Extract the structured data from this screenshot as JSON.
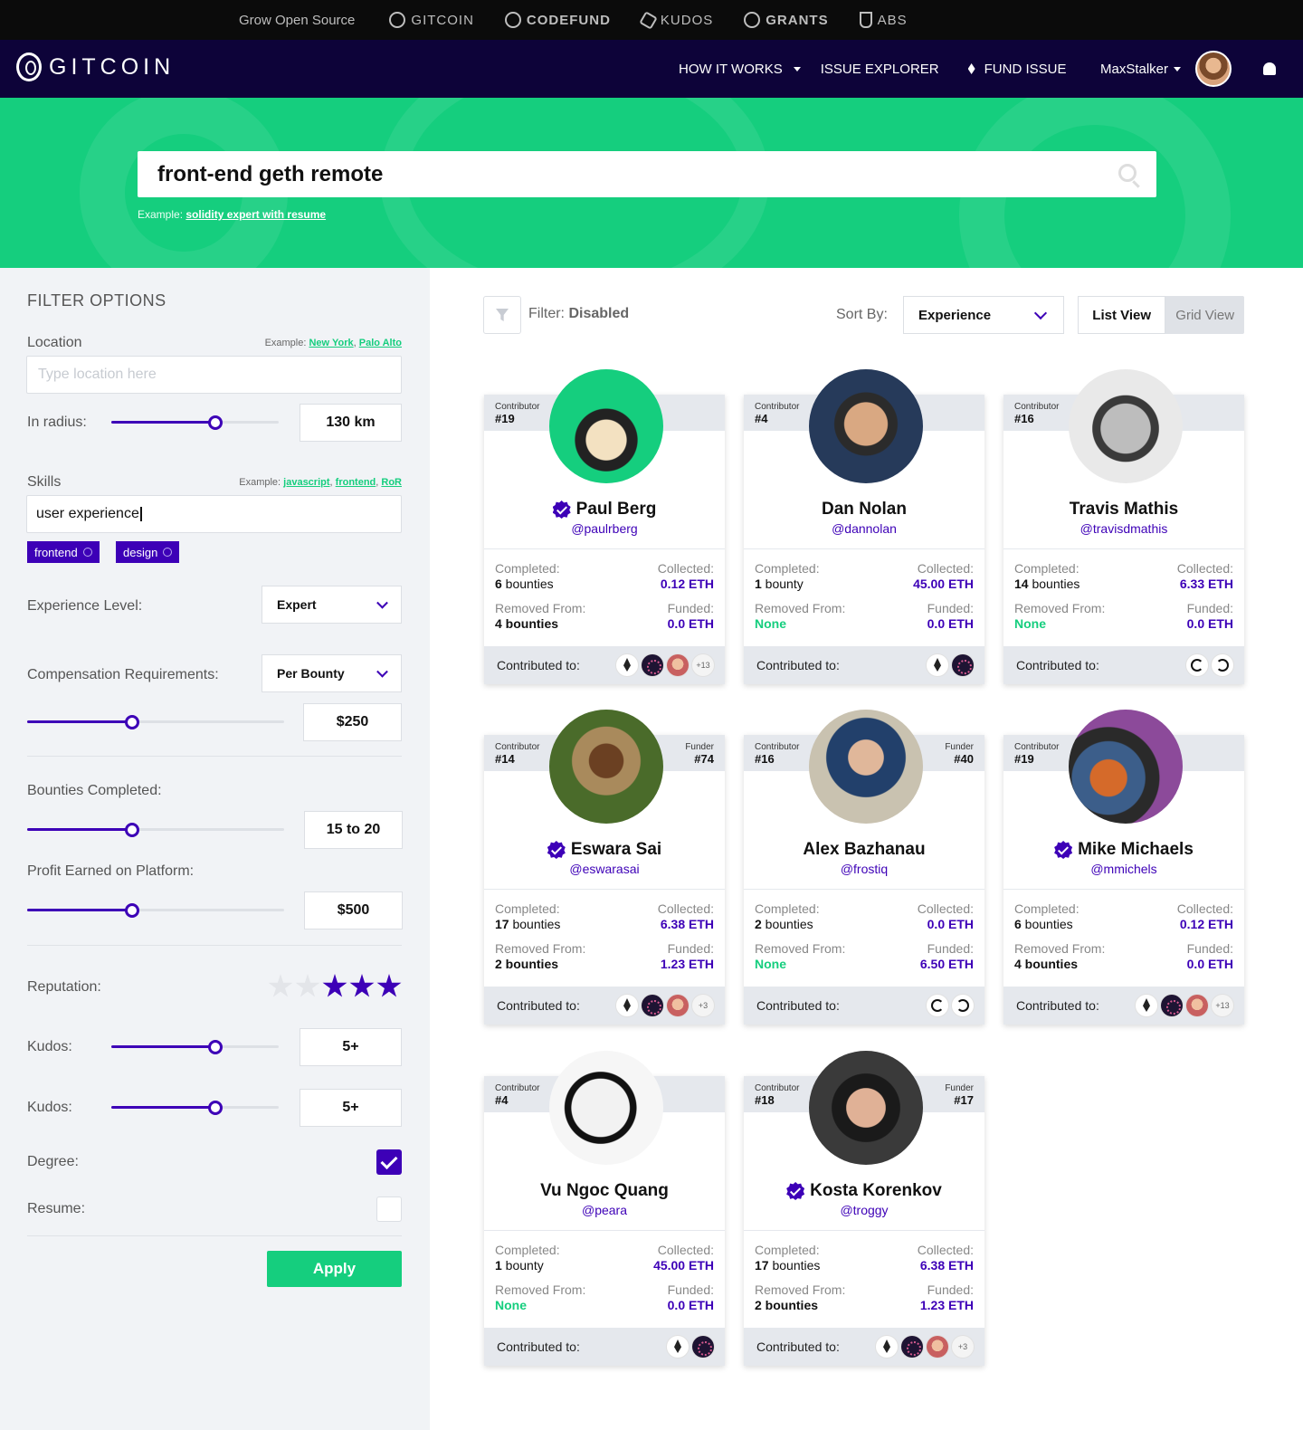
{
  "topbar": {
    "items": [
      "Grow Open Source",
      "GITCOIN",
      "CODEFUND",
      "KUDOS",
      "GRANTS",
      "ABS"
    ]
  },
  "nav": {
    "logo": "GITCOIN",
    "how_it_works": "HOW IT WORKS",
    "issue_explorer": "ISSUE EXPLORER",
    "fund_issue": "FUND ISSUE",
    "username": "MaxStalker"
  },
  "hero": {
    "search_value": "front-end geth remote",
    "example_prefix": "Example:",
    "example_link": "solidity expert with resume"
  },
  "filters": {
    "title": "FILTER OPTIONS",
    "location_label": "Location",
    "location_example_prefix": "Example:",
    "location_example_1": "New York",
    "location_example_2": "Palo Alto",
    "location_placeholder": "Type location here",
    "radius_label": "In radius:",
    "radius_value": "130 km",
    "radius_level": 0.62,
    "skills_label": "Skills",
    "skills_example_prefix": "Example:",
    "skills_example_1": "javascript",
    "skills_example_2": "frontend",
    "skills_example_3": "RoR",
    "skills_value": "user experience",
    "tags": [
      "frontend",
      "design"
    ],
    "experience_label": "Experience Level:",
    "experience_value": "Expert",
    "compensation_label": "Compensation Requirements:",
    "compensation_value": "Per Bounty",
    "compensation_amount": "$250",
    "compensation_level": 0.41,
    "bounties_label": "Bounties Completed:",
    "bounties_value": "15 to 20",
    "bounties_level": 0.41,
    "profit_label": "Profit Earned on Platform:",
    "profit_value": "$500",
    "profit_level": 0.41,
    "reputation_label": "Reputation:",
    "reputation_stars": 3,
    "reputation_max": 5,
    "kudos_label": "Kudos:",
    "kudos_value": "5+",
    "kudos_level": 0.62,
    "kudos2_label": "Kudos:",
    "kudos2_value": "5+",
    "kudos2_level": 0.62,
    "degree_label": "Degree:",
    "degree_checked": true,
    "resume_label": "Resume:",
    "resume_checked": false,
    "apply_label": "Apply"
  },
  "toolbar": {
    "filter_prefix": "Filter:",
    "filter_state": "Disabled",
    "sort_label": "Sort By:",
    "sort_value": "Experience",
    "list_view": "List View",
    "grid_view": "Grid View"
  },
  "labels": {
    "contributor": "Contributor",
    "funder": "Funder",
    "completed": "Completed:",
    "collected": "Collected:",
    "removed_from": "Removed From:",
    "funded": "Funded:",
    "contributed_to": "Contributed to:"
  },
  "cards": [
    {
      "contributor_rank": "#19",
      "funder_rank": "",
      "name": "Paul Berg",
      "handle": "@paulrberg",
      "verified": true,
      "completed_num": "6",
      "completed_unit": " bounties",
      "collected": "0.12 ETH",
      "removed_num": "4",
      "removed_unit": " bounties",
      "removed_none": false,
      "funded": "0.0 ETH",
      "chips": [
        "eth",
        "dark",
        "face",
        "+13"
      ]
    },
    {
      "contributor_rank": "#4",
      "funder_rank": "",
      "name": "Dan Nolan",
      "handle": "@dannolan",
      "verified": false,
      "completed_num": "1",
      "completed_unit": " bounty",
      "collected": "45.00 ETH",
      "removed_num": "None",
      "removed_unit": "",
      "removed_none": true,
      "funded": "0.0 ETH",
      "chips": [
        "eth",
        "dark"
      ]
    },
    {
      "contributor_rank": "#16",
      "funder_rank": "",
      "name": "Travis Mathis",
      "handle": "@travisdmathis",
      "verified": false,
      "completed_num": "14",
      "completed_unit": " bounties",
      "collected": "6.33 ETH",
      "removed_num": "None",
      "removed_unit": "",
      "removed_none": true,
      "funded": "0.0 ETH",
      "chips": [
        "ring1",
        "ring2"
      ]
    },
    {
      "contributor_rank": "#14",
      "funder_rank": "#74",
      "name": "Eswara Sai",
      "handle": "@eswarasai",
      "verified": true,
      "completed_num": "17",
      "completed_unit": " bounties",
      "collected": "6.38 ETH",
      "removed_num": "2",
      "removed_unit": " bounties",
      "removed_none": false,
      "funded": "1.23 ETH",
      "chips": [
        "eth",
        "dark",
        "face",
        "+3"
      ]
    },
    {
      "contributor_rank": "#16",
      "funder_rank": "#40",
      "name": "Alex Bazhanau",
      "handle": "@frostiq",
      "verified": false,
      "completed_num": "2",
      "completed_unit": " bounties",
      "collected": "0.0 ETH",
      "removed_num": "None",
      "removed_unit": "",
      "removed_none": true,
      "funded": "6.50 ETH",
      "chips": [
        "ring1",
        "ring2"
      ]
    },
    {
      "contributor_rank": "#19",
      "funder_rank": "",
      "name": "Mike Michaels",
      "handle": "@mmichels",
      "verified": true,
      "completed_num": "6",
      "completed_unit": " bounties",
      "collected": "0.12 ETH",
      "removed_num": "4",
      "removed_unit": " bounties",
      "removed_none": false,
      "funded": "0.0 ETH",
      "chips": [
        "eth",
        "dark",
        "face",
        "+13"
      ]
    },
    {
      "contributor_rank": "#4",
      "funder_rank": "",
      "name": "Vu Ngoc Quang",
      "handle": "@peara",
      "verified": false,
      "completed_num": "1",
      "completed_unit": " bounty",
      "collected": "45.00 ETH",
      "removed_num": "None",
      "removed_unit": "",
      "removed_none": true,
      "funded": "0.0 ETH",
      "chips": [
        "eth",
        "dark"
      ]
    },
    {
      "contributor_rank": "#18",
      "funder_rank": "#17",
      "name": "Kosta Korenkov",
      "handle": "@troggy",
      "verified": true,
      "completed_num": "17",
      "completed_unit": " bounties",
      "collected": "6.38 ETH",
      "removed_num": "2",
      "removed_unit": " bounties",
      "removed_none": false,
      "funded": "1.23 ETH",
      "chips": [
        "eth",
        "dark",
        "face",
        "+3"
      ]
    }
  ],
  "colors": {
    "brand_green": "#15ce7e",
    "brand_purple": "#3d00b7",
    "nav_bg": "#0d0339"
  }
}
